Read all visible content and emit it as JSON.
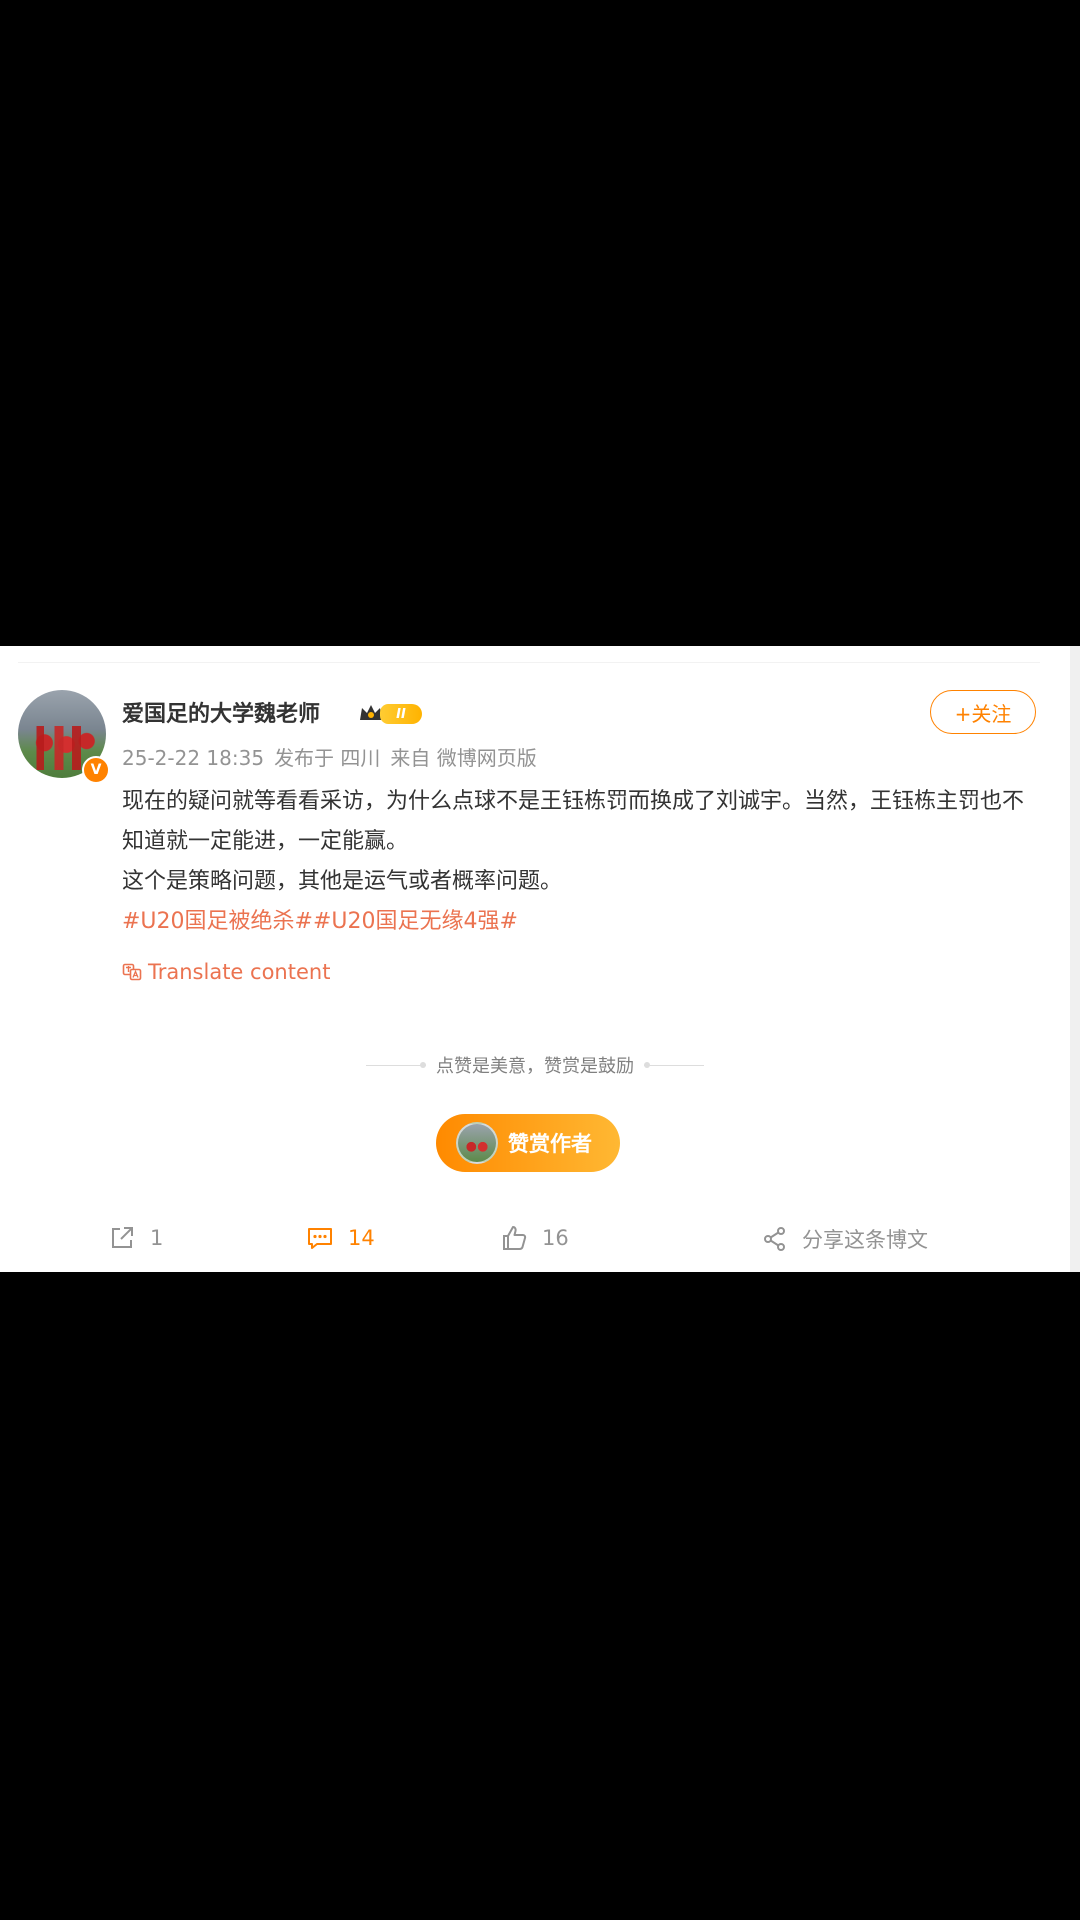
{
  "post": {
    "author": "爱国足的大学魏老师",
    "verified_mark": "V",
    "level_badge": "II",
    "timestamp": "25-2-22 18:35",
    "location": "发布于 四川",
    "source": "来自 微博网页版",
    "follow_label": "+关注",
    "body_line1": "现在的疑问就等看看采访，为什么点球不是王钰栋罚而换成了刘诚宇。当然，王钰栋主罚也不知道就一定能进，一定能赢。",
    "body_line2": "这个是策略问题，其他是运气或者概率问题。",
    "topic1": "#U20国足被绝杀#",
    "topic2": "#U20国足无缘4强#",
    "translate_label": "Translate content"
  },
  "reward": {
    "hint": "点赞是美意，赞赏是鼓励",
    "button_label": "赞赏作者"
  },
  "actions": {
    "repost_count": "1",
    "comment_count": "14",
    "like_count": "16",
    "share_label": "分享这条博文"
  },
  "colors": {
    "accent": "#ff8200",
    "topic": "#eb7350",
    "meta_text": "#939393"
  },
  "icons": [
    "repost-icon",
    "comment-icon",
    "like-icon",
    "share-icon",
    "translate-icon",
    "crown-icon"
  ]
}
